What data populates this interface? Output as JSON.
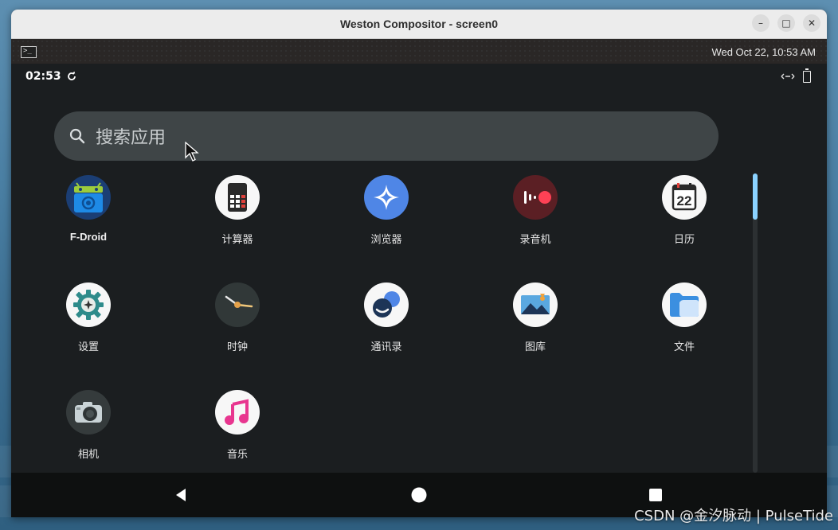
{
  "window": {
    "title": "Weston Compositor - screen0",
    "minimize": "–",
    "maximize": "□",
    "close": "✕"
  },
  "weston": {
    "datetime": "Wed Oct 22, 10:53 AM",
    "launcher_icon": "terminal-icon"
  },
  "android": {
    "status": {
      "time": "02:53",
      "sync_icon": "sync-icon",
      "network_icon": "ethernet-icon",
      "battery_icon": "battery-charging-icon"
    },
    "search": {
      "placeholder": "搜索应用"
    },
    "apps": [
      {
        "label": "F-Droid",
        "icon": "fdroid-icon"
      },
      {
        "label": "计算器",
        "icon": "calculator-icon"
      },
      {
        "label": "浏览器",
        "icon": "browser-icon"
      },
      {
        "label": "录音机",
        "icon": "recorder-icon"
      },
      {
        "label": "日历",
        "icon": "calendar-icon",
        "badge": "22"
      },
      {
        "label": "设置",
        "icon": "settings-icon"
      },
      {
        "label": "时钟",
        "icon": "clock-icon"
      },
      {
        "label": "通讯录",
        "icon": "contacts-icon"
      },
      {
        "label": "图库",
        "icon": "gallery-icon"
      },
      {
        "label": "文件",
        "icon": "files-icon"
      },
      {
        "label": "相机",
        "icon": "camera-icon"
      },
      {
        "label": "音乐",
        "icon": "music-icon"
      }
    ],
    "nav": {
      "back_icon": "back-icon",
      "home_icon": "home-icon",
      "recents_icon": "recents-icon"
    }
  },
  "watermark": "CSDN @金汐脉动 | PulseTide",
  "colors": {
    "accent": "#8ad2ff",
    "browser": "#4f86e6",
    "recorder": "#5b1f24",
    "record_dot": "#ff4155",
    "music": "#e8368f"
  }
}
